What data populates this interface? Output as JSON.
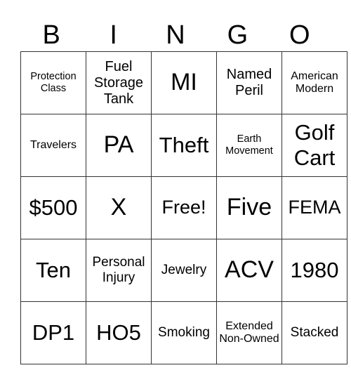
{
  "header": [
    "B",
    "I",
    "N",
    "G",
    "O"
  ],
  "rows": [
    [
      "Protection Class",
      "Fuel Storage Tank",
      "MI",
      "Named Peril",
      "American Modern"
    ],
    [
      "Travelers",
      "PA",
      "Theft",
      "Earth Movement",
      "Golf Cart"
    ],
    [
      "$500",
      "X",
      "Free!",
      "Five",
      "FEMA"
    ],
    [
      "Ten",
      "Personal Injury",
      "Jewelry",
      "ACV",
      "1980"
    ],
    [
      "DP1",
      "HO5",
      "Smoking",
      "Extended Non-Owned",
      "Stacked"
    ]
  ]
}
